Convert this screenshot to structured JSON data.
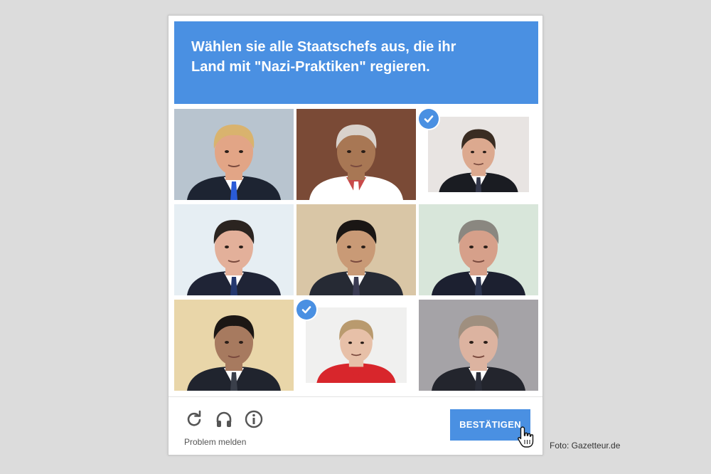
{
  "header": {
    "title": "Wählen sie alle Staatschefs aus, die ihr Land mit \"Nazi-Praktiken\" regieren."
  },
  "tiles": [
    {
      "selected": false,
      "bg": "#b8c4cf",
      "skin": "#e2a586",
      "hair": "#d9b36e",
      "suit": "#1d2432",
      "shirt": "#ffffff",
      "accent": "#2a5bd7"
    },
    {
      "selected": false,
      "bg": "#7a4a36",
      "skin": "#a87754",
      "hair": "#d9d2cc",
      "suit": "#ffffff",
      "shirt": "#c94a4a",
      "accent": "#ffffff"
    },
    {
      "selected": true,
      "bg": "#e8e4e2",
      "skin": "#dca98f",
      "hair": "#3a2c22",
      "suit": "#1a1c22",
      "shirt": "#ffffff",
      "accent": "#33374a"
    },
    {
      "selected": false,
      "bg": "#e6eef3",
      "skin": "#e3b09a",
      "hair": "#2b2420",
      "suit": "#1f2436",
      "shirt": "#ffffff",
      "accent": "#24386f"
    },
    {
      "selected": false,
      "bg": "#d9c6a6",
      "skin": "#c99a76",
      "hair": "#1a1614",
      "suit": "#262a34",
      "shirt": "#ffffff",
      "accent": "#3a3b52"
    },
    {
      "selected": false,
      "bg": "#d8e6da",
      "skin": "#d6a08a",
      "hair": "#8a8780",
      "suit": "#1c2030",
      "shirt": "#ffffff",
      "accent": "#2c3550"
    },
    {
      "selected": false,
      "bg": "#e9d6a9",
      "skin": "#a77a5f",
      "hair": "#1c1714",
      "suit": "#20242e",
      "shirt": "#ffffff",
      "accent": "#3a3f4a"
    },
    {
      "selected": true,
      "bg": "#f0f0ef",
      "skin": "#e7c0a8",
      "hair": "#b99a6e",
      "suit": "#d8262c",
      "shirt": "#d8262c",
      "accent": "#d8262c"
    },
    {
      "selected": false,
      "bg": "#a5a3a7",
      "skin": "#dcb3a0",
      "hair": "#9f8f7f",
      "suit": "#23252d",
      "shirt": "#ffffff",
      "accent": "#2a2d38"
    }
  ],
  "footer": {
    "icons": [
      "reload-icon",
      "headphones-icon",
      "info-icon"
    ],
    "problem_link": "Problem melden",
    "confirm_label": "BESTÄTIGEN"
  },
  "credit": "Foto: Gazetteur.de",
  "colors": {
    "accent": "#4a90e2",
    "page_background": "#dcdcdc"
  }
}
